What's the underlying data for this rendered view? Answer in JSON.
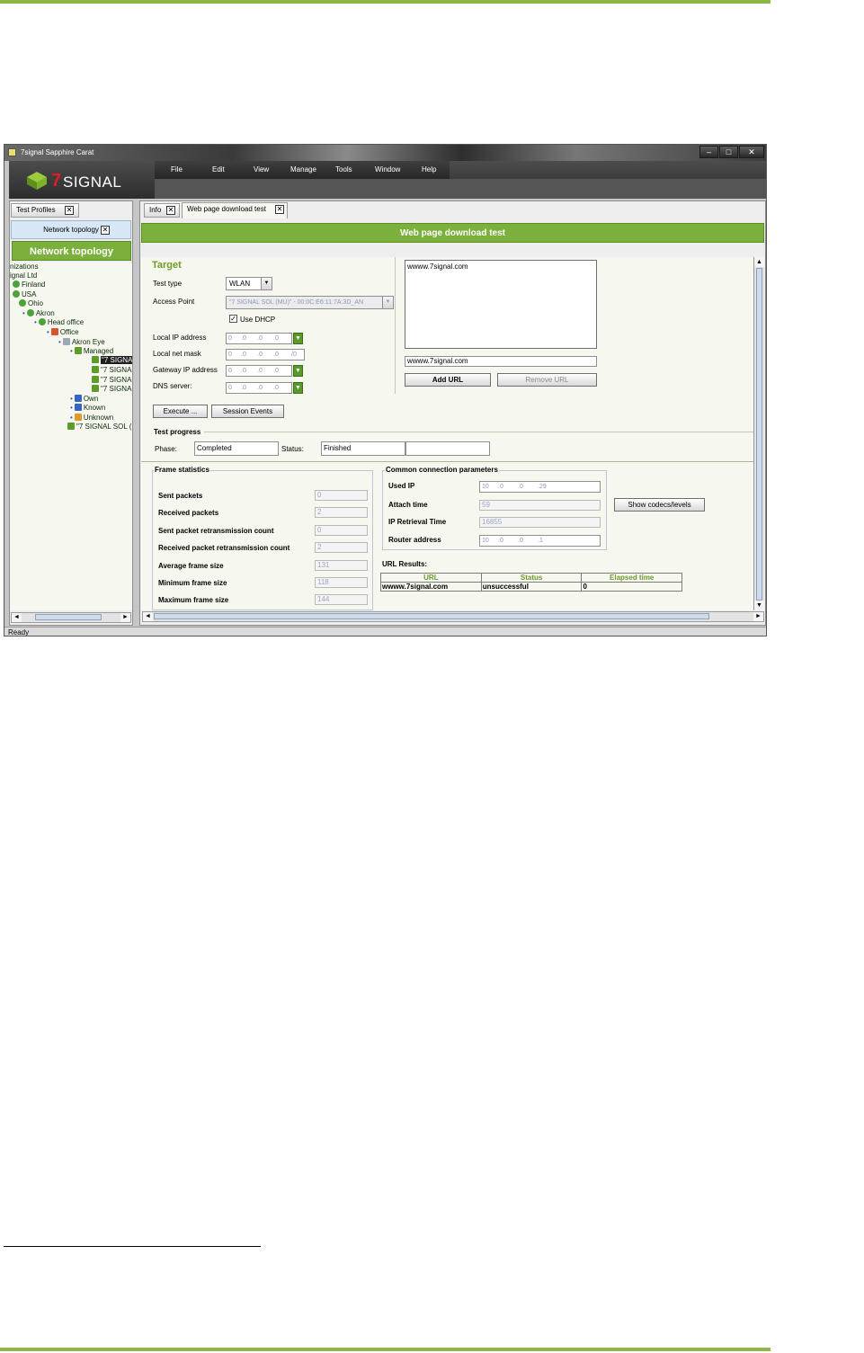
{
  "window": {
    "title": "7signal Sapphire Carat",
    "minimize": "‒",
    "maximize": "□",
    "close": "✕"
  },
  "logo": {
    "seven": "7",
    "text": "SIGNAL"
  },
  "menu": [
    "File",
    "Edit",
    "View",
    "Manage",
    "Tools",
    "Window",
    "Help"
  ],
  "left": {
    "tab_label": "Test Profiles",
    "subtab_label": "Network topology",
    "banner": "Network topology",
    "tree": [
      {
        "label": "nizations",
        "icon": ""
      },
      {
        "label": "ignal Ltd",
        "icon": ""
      },
      {
        "label": "Finland",
        "icon": "globe"
      },
      {
        "label": "USA",
        "icon": "globe"
      },
      {
        "label": "Ohio",
        "icon": "globe"
      },
      {
        "label": "Akron",
        "icon": "globe"
      },
      {
        "label": "Head office",
        "icon": "globe"
      },
      {
        "label": "Office",
        "icon": "red"
      },
      {
        "label": "Akron Eye",
        "icon": "box"
      },
      {
        "label": "Managed",
        "icon": "ap"
      },
      {
        "label": "\"7 SIGNA",
        "icon": "ap"
      },
      {
        "label": "\"7 SIGNA",
        "icon": "ap"
      },
      {
        "label": "\"7 SIGNA",
        "icon": "ap"
      },
      {
        "label": "\"7 SIGNA",
        "icon": "ap"
      },
      {
        "label": "Own",
        "icon": "blue"
      },
      {
        "label": "Known",
        "icon": "blue"
      },
      {
        "label": "Unknown",
        "icon": "orange"
      },
      {
        "label": "\"7 SIGNAL SOL (",
        "icon": "ap"
      }
    ]
  },
  "tabs": {
    "info": "Info",
    "web_test": "Web page download test",
    "close_glyph": "✕"
  },
  "panel_title": "Web page download test",
  "target": {
    "heading": "Target",
    "test_type_label": "Test type",
    "test_type_value": "WLAN",
    "access_point_label": "Access Point",
    "access_point_value": "\"7 SIGNAL SOL (MU)\" - 00:0C:E6:11:7A:3D_AN",
    "use_dhcp_label": "Use DHCP",
    "check_glyph": "✓",
    "local_ip_label": "Local IP address",
    "local_mask_label": "Local net mask",
    "gateway_label": "Gateway IP address",
    "dns_label": "DNS server:",
    "ip_placeholder": [
      "0",
      ".0",
      ".0",
      ".0"
    ],
    "mask_placeholder": [
      "0",
      ".0",
      ".0",
      ".0",
      "/0"
    ],
    "dropdown_glyph": "▼"
  },
  "urls": {
    "list_items": [
      "wwww.7signal.com"
    ],
    "input_value": "wwww.7signal.com",
    "add_label": "Add URL",
    "remove_label": "Remove URL"
  },
  "actions": {
    "execute_label": "Execute ...",
    "session_label": "Session Events"
  },
  "progress": {
    "heading": "Test progress",
    "phase_label": "Phase:",
    "phase_value": "Completed",
    "status_label": "Status:",
    "status_value": "Finished"
  },
  "frame_stats": {
    "heading": "Frame statistics",
    "rows": [
      {
        "label": "Sent packets",
        "value": "0"
      },
      {
        "label": "Received packets",
        "value": "2"
      },
      {
        "label": "Sent packet retransmission count",
        "value": "0"
      },
      {
        "label": "Received packet retransmission count",
        "value": "2"
      },
      {
        "label": "Average frame size",
        "value": "131"
      },
      {
        "label": "Minimum frame size",
        "value": "118"
      },
      {
        "label": "Maximum frame size",
        "value": "144"
      }
    ]
  },
  "conn_params": {
    "heading": "Common connection parameters",
    "used_ip_label": "Used IP",
    "used_ip": [
      "10",
      ".0",
      ".0",
      ".29"
    ],
    "attach_label": "Attach time",
    "attach_value": "59",
    "retrieval_label": "IP Retrieval Time",
    "retrieval_value": "16855",
    "router_label": "Router address",
    "router_ip": [
      "10",
      ".0",
      ".0",
      ".1"
    ],
    "codecs_label": "Show codecs/levels"
  },
  "url_results": {
    "heading": "URL Results:",
    "columns": [
      "URL",
      "Status",
      "Elapsed time"
    ],
    "rows": [
      [
        "wwww.7signal.com",
        "unsuccessful",
        "0"
      ]
    ]
  },
  "scroll": {
    "left": "◄",
    "right": "►",
    "up": "▲",
    "down": "▼",
    "grip": "|||",
    "vgrip": "≡"
  },
  "status_bar": "Ready",
  "colors": {
    "brand_green": "#7bb03c",
    "page_rule": "#8db848",
    "logo_red": "#e01e26"
  }
}
